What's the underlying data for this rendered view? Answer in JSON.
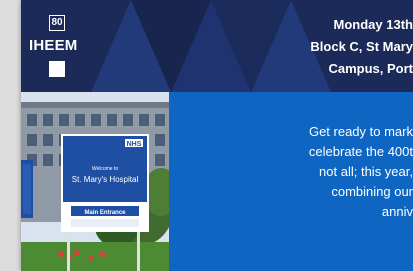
{
  "logo": {
    "badge": "80",
    "name": "IHEEM"
  },
  "event": {
    "date_line": "Monday 13th",
    "location_line_1": "Block C, St Mary",
    "location_line_2": "Campus, Port"
  },
  "hospital_sign": {
    "small_text": "Welcome to",
    "name": "St. Mary's Hospital",
    "entrance": "Main Entrance",
    "badge": "NHS"
  },
  "intro_lines": [
    "Get ready to mark",
    "celebrate the 400t",
    "not all; this year,",
    "combining our",
    "anniv"
  ],
  "colors": {
    "header_bg": "#1b2a58",
    "panel_bg": "#0e66c2",
    "sign_blue": "#1f4fa3"
  }
}
